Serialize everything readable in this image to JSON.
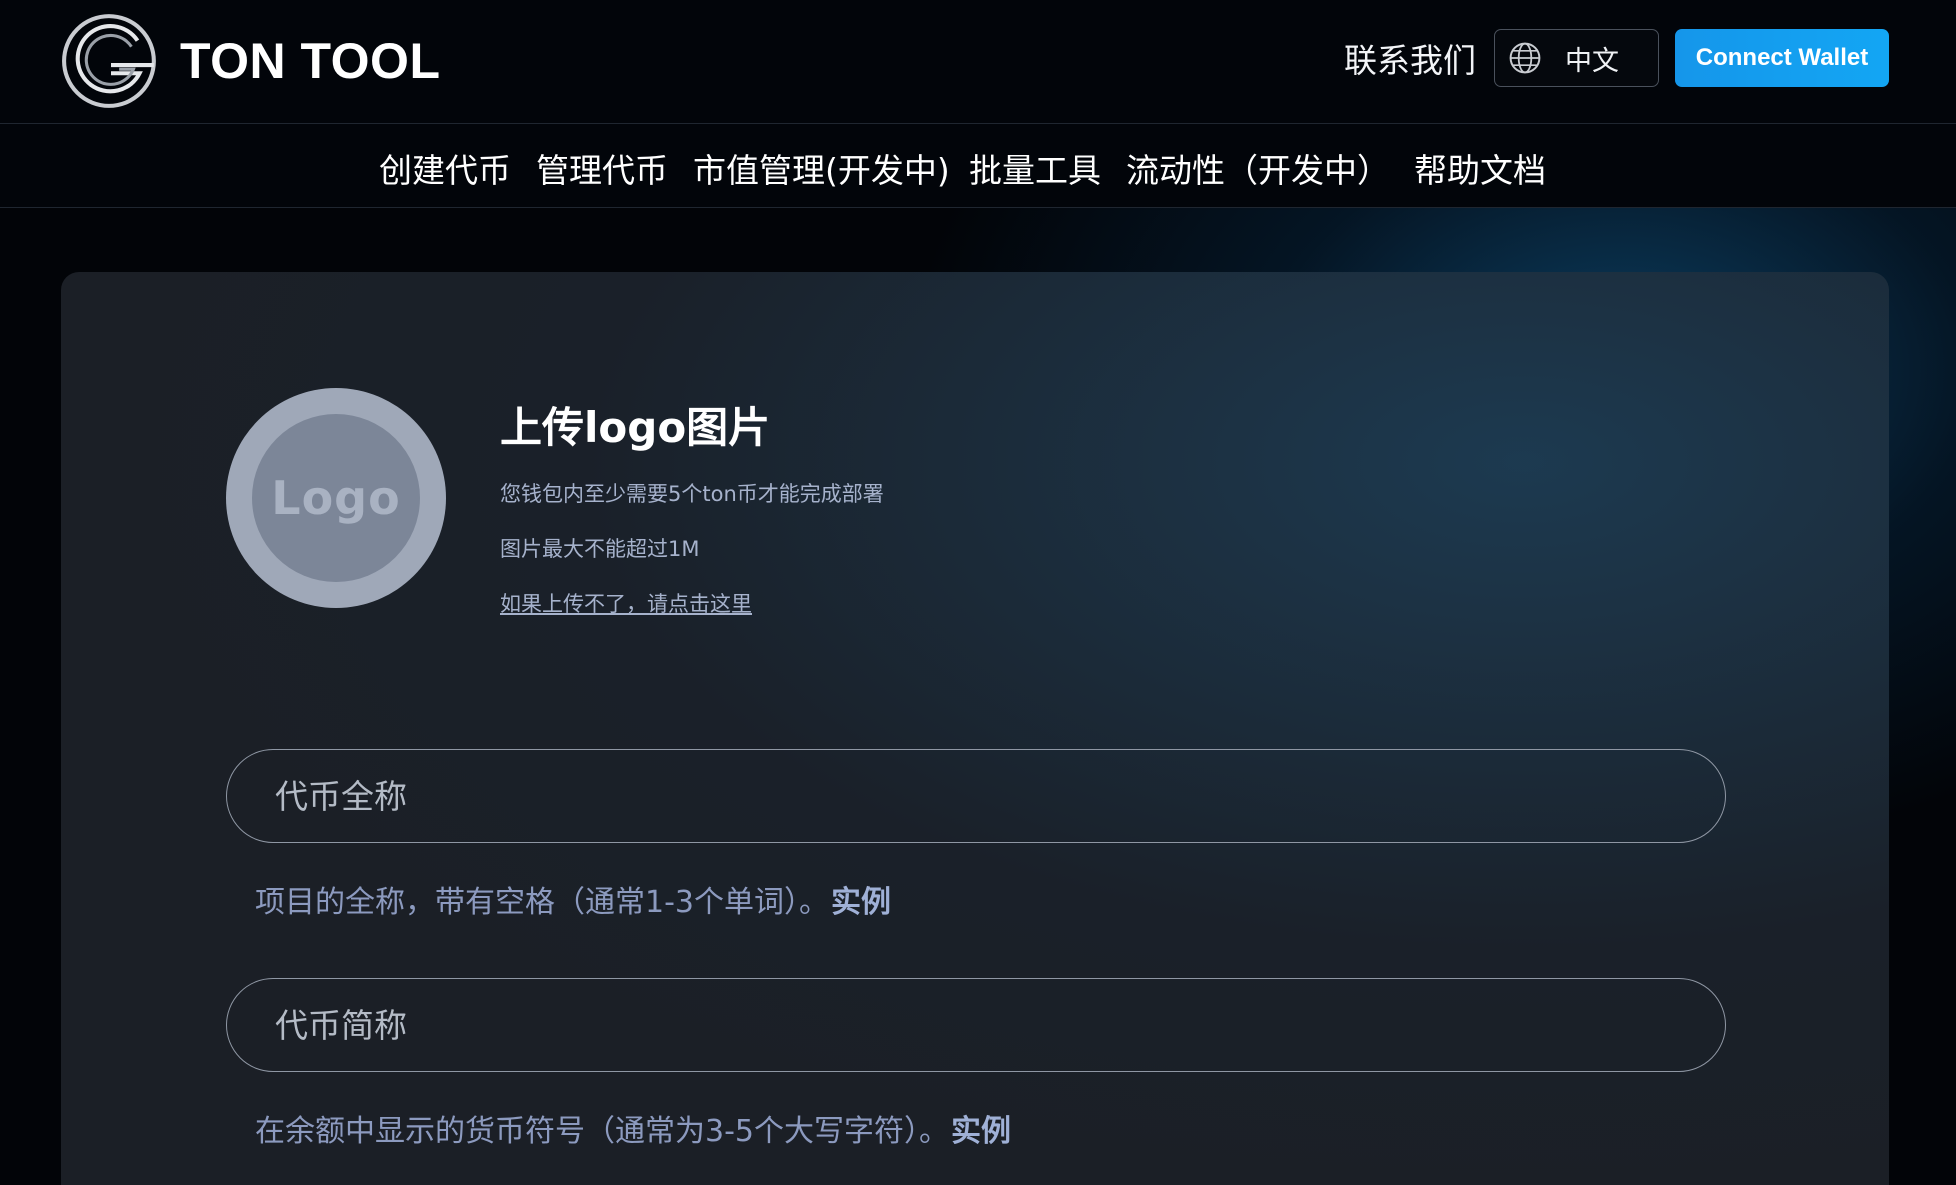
{
  "header": {
    "brand_name": "TON TOOL",
    "contact_label": "联系我们",
    "language": {
      "icon": "globe-icon",
      "label": "中文"
    },
    "connect_label": "Connect Wallet"
  },
  "nav": {
    "items": [
      {
        "label": "创建代币"
      },
      {
        "label": "管理代币"
      },
      {
        "label": "市值管理(开发中)"
      },
      {
        "label": "批量工具"
      },
      {
        "label": "流动性（开发中）"
      },
      {
        "label": "帮助文档"
      }
    ]
  },
  "upload": {
    "logo_placeholder": "Logo",
    "title": "上传logo图片",
    "note_1": "您钱包内至少需要5个ton币才能完成部署",
    "note_2": "图片最大不能超过1M",
    "help_link": "如果上传不了，请点击这里"
  },
  "form": {
    "full_name": {
      "placeholder": "代币全称",
      "help": "项目的全称，带有空格（通常1-3个单词）。",
      "example_label": "实例"
    },
    "symbol": {
      "placeholder": "代币简称",
      "help": "在余额中显示的货币符号（通常为3-5个大写字符）。",
      "example_label": "实例"
    }
  },
  "colors": {
    "accent": "#1596ea",
    "background": "#02050a",
    "card": "#1b1f26",
    "help_text": "#8c9abf"
  }
}
